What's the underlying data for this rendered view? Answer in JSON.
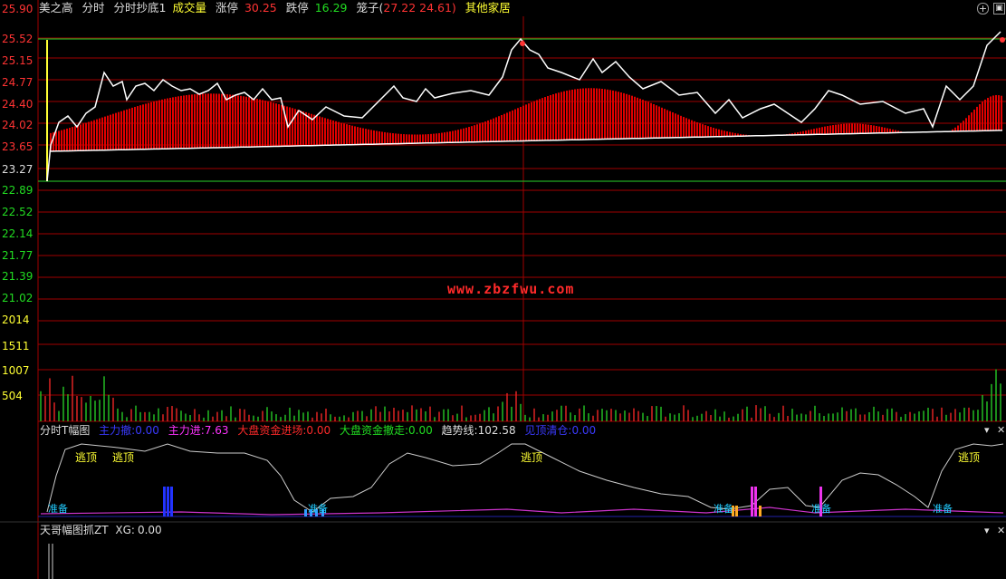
{
  "header": {
    "stock_name": "美之高",
    "mode": "分时",
    "indicator": "分时抄底1",
    "volume_label": "成交量",
    "limit_up_label": "涨停",
    "limit_up_value": "30.25",
    "limit_down_label": "跌停",
    "limit_down_value": "16.29",
    "cage_label": "笼子(",
    "cage_value": "27.22 24.61)",
    "other_label": "其他家居"
  },
  "price_axis": [
    "25.90",
    "25.52",
    "25.15",
    "24.77",
    "24.40",
    "24.02",
    "23.65",
    "23.27",
    "22.89",
    "22.52",
    "22.14",
    "21.77",
    "21.39",
    "21.02"
  ],
  "volume_axis": [
    "2014",
    "1511",
    "1007",
    "504"
  ],
  "watermark": "www.zbzfwu.com",
  "panel2": {
    "name": "分时T幅图",
    "items": [
      {
        "label": "主力撤:",
        "value": "0.00",
        "color": "#3a3aff"
      },
      {
        "label": "主力进:",
        "value": "7.63",
        "color": "#ff33ff"
      },
      {
        "label": "大盘资金进场:",
        "value": "0.00",
        "color": "#ff2a2a"
      },
      {
        "label": "大盘资金撤走:",
        "value": "0.00",
        "color": "#22dd22"
      },
      {
        "label": "趋势线:",
        "value": "102.58",
        "color": "#dddddd"
      },
      {
        "label": "见顶清仓:",
        "value": "0.00",
        "color": "#3a3aff"
      }
    ],
    "signal_top": "逃顶",
    "signal_ready": "准备"
  },
  "panel3": {
    "name": "天哥幅图抓ZT",
    "xg_label": "XG:",
    "xg_value": "0.00"
  },
  "colors": {
    "grid_red": "#a00000",
    "price_green": "#22dd22",
    "price_red": "#ff3333",
    "bar_red": "#e00000",
    "yellow": "#ffff33",
    "cyan": "#22ccff"
  },
  "icons": [
    "add-icon",
    "settings-icon",
    "collapse-icon",
    "close-icon"
  ]
}
